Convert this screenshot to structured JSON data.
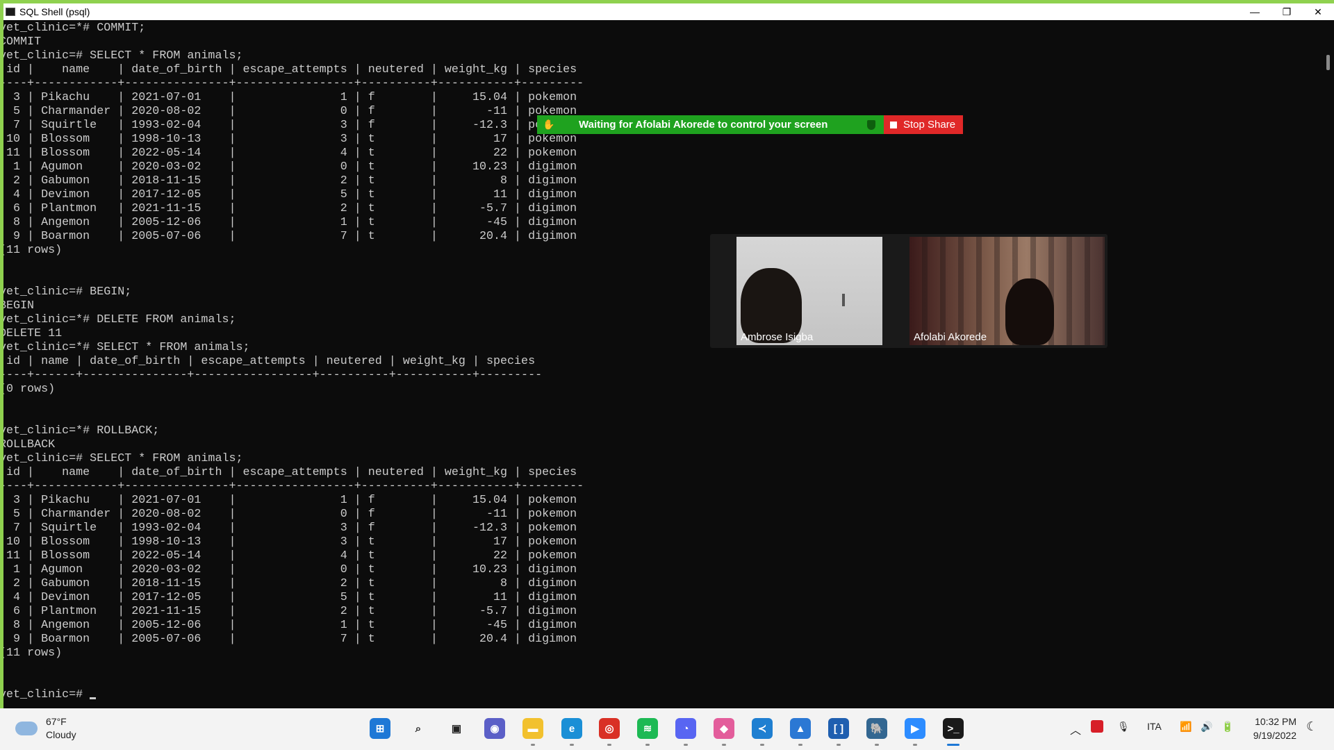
{
  "window": {
    "title": "SQL Shell (psql)",
    "minimize": "—",
    "maximize": "❐",
    "close": "✕"
  },
  "terminal": {
    "lines": [
      "vet_clinic=*# COMMIT;",
      "COMMIT",
      "vet_clinic=# SELECT * FROM animals;",
      " id |    name    | date_of_birth | escape_attempts | neutered | weight_kg | species",
      "----+------------+---------------+-----------------+----------+-----------+---------",
      "  3 | Pikachu    | 2021-07-01    |               1 | f        |     15.04 | pokemon",
      "  5 | Charmander | 2020-08-02    |               0 | f        |       -11 | pokemon",
      "  7 | Squirtle   | 1993-02-04    |               3 | f        |     -12.3 | pokemon",
      " 10 | Blossom    | 1998-10-13    |               3 | t        |        17 | pokemon",
      " 11 | Blossom    | 2022-05-14    |               4 | t        |        22 | pokemon",
      "  1 | Agumon     | 2020-03-02    |               0 | t        |     10.23 | digimon",
      "  2 | Gabumon    | 2018-11-15    |               2 | t        |         8 | digimon",
      "  4 | Devimon    | 2017-12-05    |               5 | t        |        11 | digimon",
      "  6 | Plantmon   | 2021-11-15    |               2 | t        |      -5.7 | digimon",
      "  8 | Angemon    | 2005-12-06    |               1 | t        |       -45 | digimon",
      "  9 | Boarmon    | 2005-07-06    |               7 | t        |      20.4 | digimon",
      "(11 rows)",
      "",
      "",
      "vet_clinic=# BEGIN;",
      "BEGIN",
      "vet_clinic=*# DELETE FROM animals;",
      "DELETE 11",
      "vet_clinic=*# SELECT * FROM animals;",
      " id | name | date_of_birth | escape_attempts | neutered | weight_kg | species",
      "----+------+---------------+-----------------+----------+-----------+---------",
      "(0 rows)",
      "",
      "",
      "vet_clinic=*# ROLLBACK;",
      "ROLLBACK",
      "vet_clinic=# SELECT * FROM animals;",
      " id |    name    | date_of_birth | escape_attempts | neutered | weight_kg | species",
      "----+------------+---------------+-----------------+----------+-----------+---------",
      "  3 | Pikachu    | 2021-07-01    |               1 | f        |     15.04 | pokemon",
      "  5 | Charmander | 2020-08-02    |               0 | f        |       -11 | pokemon",
      "  7 | Squirtle   | 1993-02-04    |               3 | f        |     -12.3 | pokemon",
      " 10 | Blossom    | 1998-10-13    |               3 | t        |        17 | pokemon",
      " 11 | Blossom    | 2022-05-14    |               4 | t        |        22 | pokemon",
      "  1 | Agumon     | 2020-03-02    |               0 | t        |     10.23 | digimon",
      "  2 | Gabumon    | 2018-11-15    |               2 | t        |         8 | digimon",
      "  4 | Devimon    | 2017-12-05    |               5 | t        |        11 | digimon",
      "  6 | Plantmon   | 2021-11-15    |               2 | t        |      -5.7 | digimon",
      "  8 | Angemon    | 2005-12-06    |               1 | t        |       -45 | digimon",
      "  9 | Boarmon    | 2005-07-06    |               7 | t        |      20.4 | digimon",
      "(11 rows)",
      "",
      ""
    ],
    "prompt": "vet_clinic=# "
  },
  "share_bar": {
    "message": "Waiting for Afolabi Akorede to control your screen",
    "stop_label": "Stop Share",
    "hand_icon": "✋"
  },
  "video": {
    "participants": [
      {
        "name": "Ambrose Isigba"
      },
      {
        "name": "Afolabi Akorede"
      }
    ]
  },
  "taskbar": {
    "weather": {
      "temp": "67°F",
      "condition": "Cloudy"
    },
    "language": "ITA",
    "time": "10:32 PM",
    "date": "9/19/2022",
    "apps": [
      {
        "name": "start",
        "color": "#1e78d6",
        "glyph": "⊞"
      },
      {
        "name": "search",
        "color": "#f3f3f3",
        "glyph": "⌕"
      },
      {
        "name": "task-view",
        "color": "#f3f3f3",
        "glyph": "▣"
      },
      {
        "name": "chat",
        "color": "#5b5fc7",
        "glyph": "◉"
      },
      {
        "name": "file-explorer",
        "color": "#f2c12e",
        "glyph": "▬"
      },
      {
        "name": "edge",
        "color": "#1a8fd6",
        "glyph": "e"
      },
      {
        "name": "chrome",
        "color": "#d93025",
        "glyph": "◎"
      },
      {
        "name": "spotify",
        "color": "#1db954",
        "glyph": "≋"
      },
      {
        "name": "discord",
        "color": "#5865f2",
        "glyph": "◔"
      },
      {
        "name": "app-diamond",
        "color": "#e35d9b",
        "glyph": "◆"
      },
      {
        "name": "vscode",
        "color": "#1f7fd1",
        "glyph": "≺"
      },
      {
        "name": "photos",
        "color": "#2b78d4",
        "glyph": "▲"
      },
      {
        "name": "app-bracket",
        "color": "#1f5fb0",
        "glyph": "[ ]"
      },
      {
        "name": "pgadmin",
        "color": "#336791",
        "glyph": "🐘"
      },
      {
        "name": "zoom",
        "color": "#2d8cff",
        "glyph": "▶"
      },
      {
        "name": "terminal",
        "color": "#1a1a1a",
        "glyph": ">_"
      }
    ]
  }
}
